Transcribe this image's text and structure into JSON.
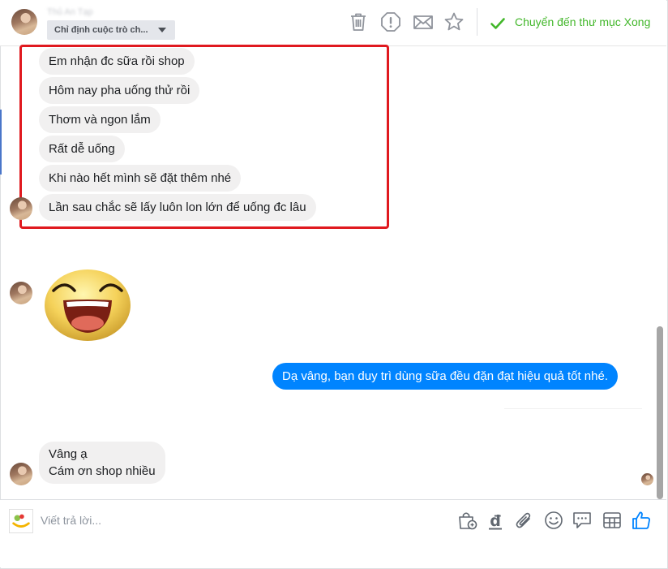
{
  "header": {
    "contact_name": "Thủ An Tạp",
    "assign_label": "Chỉ định cuộc trò ch...",
    "done_label": "Chuyển đến thư mục Xong",
    "icons": [
      "trash-icon",
      "spam-icon",
      "mail-icon",
      "star-icon",
      "check-icon"
    ]
  },
  "messages": {
    "incoming_group": [
      "Em nhận đc sữa rồi shop",
      "Hôm nay pha uống thử rồi",
      "Thơm và ngon lắm",
      "Rất dễ uống",
      "Khi nào hết mình sẽ đặt thêm nhé",
      "Lần sau chắc sẽ lấy luôn lon lớn để uống đc lâu"
    ],
    "sticker": "laughing-face-sticker",
    "outgoing": "Dạ vâng, bạn duy trì dùng sữa đều đặn đạt hiệu quả tốt nhé.",
    "last_incoming": [
      "Vâng ạ",
      "Cám ơn shop nhiều"
    ]
  },
  "composer": {
    "placeholder": "Viết trả lời...",
    "icons": [
      "store-bag-icon",
      "dong-currency-icon",
      "paperclip-icon",
      "smiley-icon",
      "chat-bubble-icon",
      "table-icon",
      "like-icon"
    ]
  },
  "colors": {
    "accent_blue": "#0084ff",
    "done_green": "#42b72a",
    "highlight_red": "#e0191f",
    "bubble_gray": "#f1f0f0"
  }
}
